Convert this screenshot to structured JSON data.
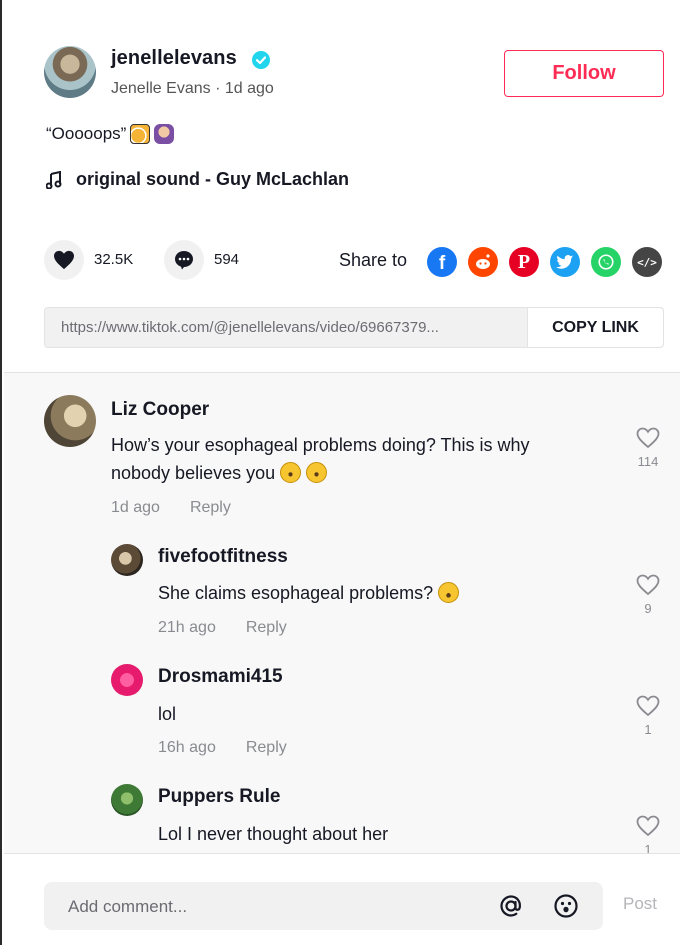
{
  "author": {
    "username": "jenellelevans",
    "display_name": "Jenelle Evans",
    "time": "1d ago",
    "subline_sep": " · ",
    "verified": true,
    "follow_label": "Follow"
  },
  "caption": {
    "text": "“Ooooops”",
    "emojis": [
      "beer-emoji",
      "woman-shrugging-emoji"
    ]
  },
  "sound": {
    "label": "original sound - Guy McLachlan"
  },
  "stats": {
    "likes": "32.5K",
    "comments": "594"
  },
  "share": {
    "label": "Share to",
    "targets": [
      {
        "name": "facebook",
        "color": "#1877f2",
        "glyph": "f"
      },
      {
        "name": "reddit",
        "color": "#ff4500",
        "glyph": "•"
      },
      {
        "name": "pinterest",
        "color": "#e60023",
        "glyph": "P"
      },
      {
        "name": "twitter",
        "color": "#1da1f2",
        "glyph": "t"
      },
      {
        "name": "whatsapp",
        "color": "#25d366",
        "glyph": "✆"
      },
      {
        "name": "embed",
        "color": "#454545",
        "glyph": "</>"
      }
    ]
  },
  "link": {
    "url": "https://www.tiktok.com/@jenellelevans/video/69667379...",
    "copy_label": "COPY LINK"
  },
  "comments": [
    {
      "name": "Liz Cooper",
      "text_line1": "How’s your esophageal problems doing? This is why",
      "text_line2": "nobody believes you",
      "time": "1d ago",
      "reply": "Reply",
      "likes": "114",
      "level": 0
    },
    {
      "name": "fivefootfitness",
      "text_line1": "She claims esophageal problems?",
      "text_line2": "",
      "time": "21h ago",
      "reply": "Reply",
      "likes": "9",
      "level": 1
    },
    {
      "name": "Drosmami415",
      "text_line1": "lol",
      "text_line2": "",
      "time": "16h ago",
      "reply": "Reply",
      "likes": "1",
      "level": 1
    },
    {
      "name": "Puppers Rule",
      "text_line1": "Lol I never thought about her",
      "text_line2": "",
      "time": "",
      "reply": "",
      "likes": "1",
      "level": 1
    }
  ],
  "composer": {
    "placeholder": "Add comment...",
    "post_label": "Post"
  },
  "colors": {
    "accent": "#fe2c55",
    "verified": "#20d5ec"
  }
}
